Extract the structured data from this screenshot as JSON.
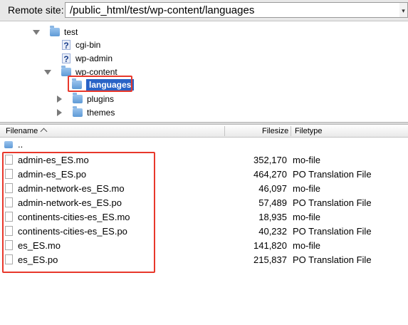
{
  "site_bar": {
    "label": "Remote site:",
    "path": "/public_html/test/wp-content/languages"
  },
  "tree": {
    "items": [
      {
        "label": "test",
        "icon": "folder-icon",
        "expander": "expanded"
      },
      {
        "label": "cgi-bin",
        "icon": "question-icon",
        "expander": "none"
      },
      {
        "label": "wp-admin",
        "icon": "question-icon",
        "expander": "none"
      },
      {
        "label": "wp-content",
        "icon": "folder-icon",
        "expander": "expanded"
      },
      {
        "label": "languages",
        "icon": "folder-icon",
        "expander": "none",
        "selected": true
      },
      {
        "label": "plugins",
        "icon": "folder-icon",
        "expander": "collapsed"
      },
      {
        "label": "themes",
        "icon": "folder-icon",
        "expander": "collapsed"
      }
    ]
  },
  "file_list": {
    "columns": {
      "filename": "Filename",
      "filesize": "Filesize",
      "filetype": "Filetype"
    },
    "parent_label": "..",
    "rows": [
      {
        "name": "admin-es_ES.mo",
        "size": "352,170",
        "type": "mo-file"
      },
      {
        "name": "admin-es_ES.po",
        "size": "464,270",
        "type": "PO Translation File"
      },
      {
        "name": "admin-network-es_ES.mo",
        "size": "46,097",
        "type": "mo-file"
      },
      {
        "name": "admin-network-es_ES.po",
        "size": "57,489",
        "type": "PO Translation File"
      },
      {
        "name": "continents-cities-es_ES.mo",
        "size": "18,935",
        "type": "mo-file"
      },
      {
        "name": "continents-cities-es_ES.po",
        "size": "40,232",
        "type": "PO Translation File"
      },
      {
        "name": "es_ES.mo",
        "size": "141,820",
        "type": "mo-file"
      },
      {
        "name": "es_ES.po",
        "size": "215,837",
        "type": "PO Translation File"
      }
    ]
  },
  "colors": {
    "highlight_border": "#e8382b",
    "selection": "#2a63c6",
    "folder": "#5f9ad6"
  }
}
